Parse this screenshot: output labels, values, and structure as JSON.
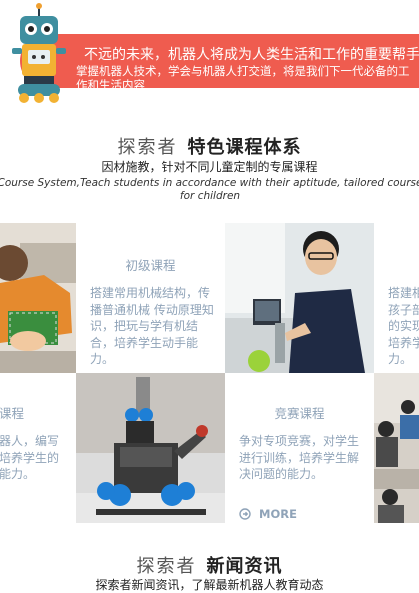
{
  "banner": {
    "line1": "不远的未来，机器人将成为人类生活和工作的重要帮手",
    "line2": "掌握机器人技术，学会与机器人打交道，将是我们下一代必备的工作和生活内容"
  },
  "courses_section": {
    "title_light": "探索者",
    "title_bold": "特色课程体系",
    "subtitle_cn": "因材施教，针对不同儿童定制的专属课程",
    "subtitle_en": "Course System,Teach students in accordance with their aptitude, tailored course for children"
  },
  "cards": {
    "beginner": {
      "title": "初级课程",
      "desc": "搭建常用机械结构，传播普通机械 传动原理知识，把玩与学有机结合，培养学生动手能力。"
    },
    "right_partial": {
      "desc": "搭建相让孩子部中的实现机培养学能力。"
    },
    "left_partial": {
      "title": "课程",
      "desc": "器人，编写培养学生的能力。"
    },
    "competition": {
      "title": "竞赛课程",
      "desc": "争对专项竞赛，对学生进行训练，培养学生解决问题的能力。",
      "more": "MORE"
    }
  },
  "news_section": {
    "title_light": "探索者",
    "title_bold": "新闻资讯",
    "subtitle_cn": "探索者新闻资讯，了解最新机器人教育动态"
  }
}
